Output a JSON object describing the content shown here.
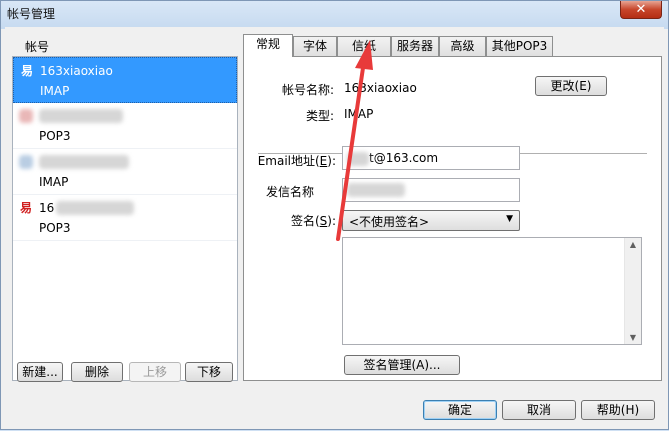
{
  "window": {
    "title": "帐号管理",
    "close_glyph": "✕"
  },
  "accounts": {
    "label": "帐号",
    "items": [
      {
        "icon": "易",
        "name": "163xiaoxiao",
        "type": "IMAP",
        "selected": true
      },
      {
        "icon": "",
        "name": "",
        "type": "POP3",
        "selected": false
      },
      {
        "icon": "",
        "name": "",
        "type": "IMAP",
        "selected": false
      },
      {
        "icon": "易",
        "name": "16",
        "type": "POP3",
        "selected": false
      }
    ],
    "buttons": {
      "new": "新建...",
      "delete": "删除",
      "move_up": "上移",
      "move_down": "下移"
    }
  },
  "tabs": [
    "常规",
    "字体",
    "信纸",
    "服务器",
    "高级",
    "其他POP3"
  ],
  "general": {
    "account_name_label": "帐号名称:",
    "account_name_value": "163xiaoxiao",
    "change_button": "更改(E)",
    "type_label": "类型:",
    "type_value": "IMAP",
    "email_label": "Email地址(",
    "email_label_key": "E",
    "email_label_end": "):",
    "email_value": "t@163.com",
    "sender_label": "发信名称",
    "signature_label": "签名(",
    "signature_label_key": "S",
    "signature_label_end": "):",
    "signature_value": "<不使用签名>",
    "signature_manage_button": "签名管理(A)..."
  },
  "footer": {
    "ok": "确定",
    "cancel": "取消",
    "help": "帮助(H)"
  },
  "icons": {
    "account": "mail-account-icon",
    "dropdown": "chevron-down-icon"
  },
  "colors": {
    "selection": "#3399ff",
    "annotation_arrow": "#e83a3a"
  }
}
